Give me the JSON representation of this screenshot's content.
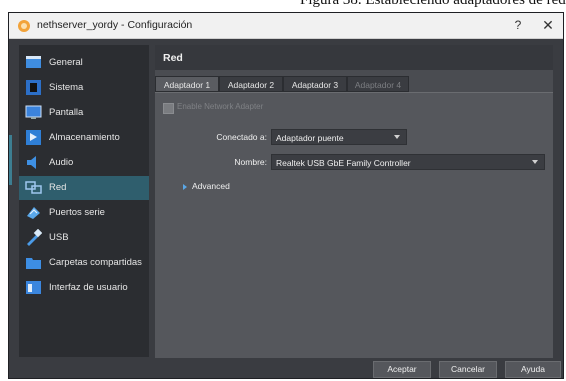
{
  "caption": "Figura 38. Estableciendo adaptadores de red.",
  "window": {
    "title": "nethserver_yordy - Configuración",
    "help_label": "?",
    "close_label": "✕"
  },
  "sidebar": {
    "items": [
      {
        "label": "General",
        "icon": "general-icon"
      },
      {
        "label": "Sistema",
        "icon": "system-icon"
      },
      {
        "label": "Pantalla",
        "icon": "display-icon"
      },
      {
        "label": "Almacenamiento",
        "icon": "storage-icon"
      },
      {
        "label": "Audio",
        "icon": "audio-icon"
      },
      {
        "label": "Red",
        "icon": "network-icon",
        "active": true
      },
      {
        "label": "Puertos serie",
        "icon": "serial-ports-icon"
      },
      {
        "label": "USB",
        "icon": "usb-icon"
      },
      {
        "label": "Carpetas compartidas",
        "icon": "shared-folder-icon"
      },
      {
        "label": "Interfaz de usuario",
        "icon": "user-interface-icon"
      }
    ]
  },
  "panel": {
    "title": "Red",
    "tabs": [
      {
        "label": "Adaptador 1",
        "active": true
      },
      {
        "label": "Adaptador 2"
      },
      {
        "label": "Adaptador 3"
      },
      {
        "label": "Adaptador 4",
        "disabled": true
      }
    ],
    "enable_label": "Enable Network Adapter",
    "attached_label": "Conectado a:",
    "attached_value": "Adaptador puente",
    "name_label": "Nombre:",
    "name_value": "Realtek USB GbE Family Controller",
    "advanced_label": "Advanced"
  },
  "buttons": {
    "ok": "Aceptar",
    "cancel": "Cancelar",
    "help": "Ayuda"
  },
  "colors": {
    "accent": "#2f5e6d",
    "window_bg": "#3a3c41",
    "panel_bg": "#4a4c51"
  }
}
